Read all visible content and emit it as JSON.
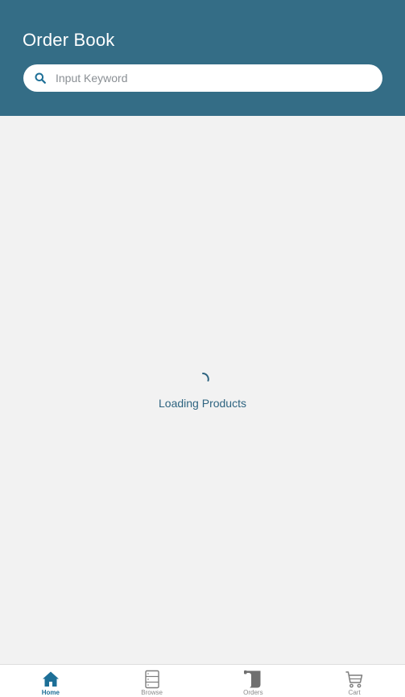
{
  "header": {
    "title": "Order Book",
    "search": {
      "placeholder": "Input Keyword",
      "value": "",
      "icon": "search-icon"
    }
  },
  "content": {
    "loading_text": "Loading Products",
    "spinner": "loading-spinner-icon"
  },
  "tabbar": {
    "active": "Home",
    "tabs": [
      {
        "label": "Home",
        "icon": "home-icon"
      },
      {
        "label": "Browse",
        "icon": "browse-icon"
      },
      {
        "label": "Orders",
        "icon": "orders-icon"
      },
      {
        "label": "Cart",
        "icon": "cart-icon"
      }
    ]
  },
  "colors": {
    "header_bg": "#346d86",
    "accent": "#1d6f97",
    "page_bg": "#f2f2f2",
    "inactive_tab": "#8a8a8a"
  }
}
